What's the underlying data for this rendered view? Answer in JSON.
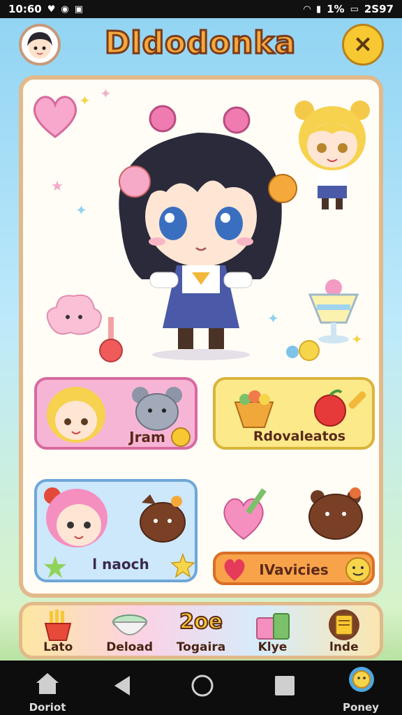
{
  "status_bar": {
    "time": "10:60",
    "battery_percent": "1%",
    "clock_right": "2S97"
  },
  "header": {
    "title": "Dldodonka",
    "close_symbol": "×"
  },
  "cards": [
    {
      "id": "jram",
      "label": "Jram"
    },
    {
      "id": "rdovaleatos",
      "label": "Rdovaleatos"
    },
    {
      "id": "lnaoch",
      "label": "l naoch"
    },
    {
      "id": "vavicies",
      "label": "IVavicies"
    }
  ],
  "bottom_tabs": [
    {
      "label": "Lato",
      "icon": "fries-icon"
    },
    {
      "label": "Deload",
      "icon": "bowl-icon"
    },
    {
      "label": "Togaira",
      "icon": "number-badge",
      "badge": "2oe"
    },
    {
      "label": "Klye",
      "icon": "gift-icon"
    },
    {
      "label": "lnde",
      "icon": "book-icon"
    }
  ],
  "navbar": {
    "home_label": "Doriot",
    "right_label": "Poney"
  },
  "colors": {
    "accent": "#f7c832",
    "pink_card": "#f7b5d5",
    "yellow_card": "#fbe98a",
    "blue_card": "#cde7fb",
    "orange_pill": "#f8a24a"
  }
}
